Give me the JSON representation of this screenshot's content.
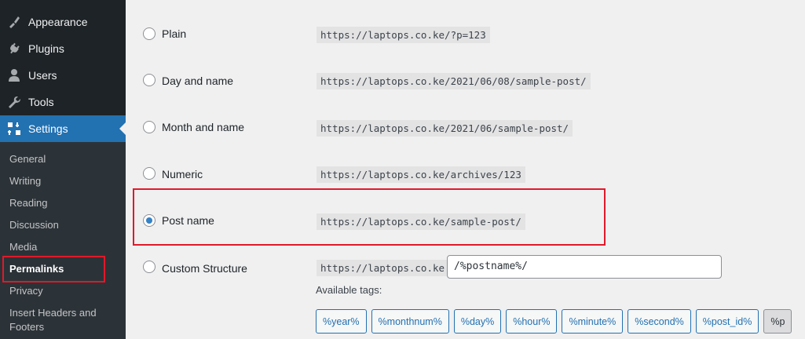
{
  "sidebar": {
    "menu": [
      {
        "label": "Appearance",
        "icon": "paintbrush-icon"
      },
      {
        "label": "Plugins",
        "icon": "plug-icon"
      },
      {
        "label": "Users",
        "icon": "user-icon"
      },
      {
        "label": "Tools",
        "icon": "wrench-icon"
      },
      {
        "label": "Settings",
        "icon": "settings-icon",
        "current": true
      }
    ],
    "submenu": [
      "General",
      "Writing",
      "Reading",
      "Discussion",
      "Media",
      "Permalinks",
      "Privacy",
      "Insert Headers and Footers"
    ]
  },
  "permalinks": {
    "options": [
      {
        "label": "Plain",
        "example": "https://laptops.co.ke/?p=123",
        "checked": false
      },
      {
        "label": "Day and name",
        "example": "https://laptops.co.ke/2021/06/08/sample-post/",
        "checked": false
      },
      {
        "label": "Month and name",
        "example": "https://laptops.co.ke/2021/06/sample-post/",
        "checked": false
      },
      {
        "label": "Numeric",
        "example": "https://laptops.co.ke/archives/123",
        "checked": false
      },
      {
        "label": "Post name",
        "example": "https://laptops.co.ke/sample-post/",
        "checked": true
      },
      {
        "label": "Custom Structure",
        "example": "https://laptops.co.ke",
        "checked": false
      }
    ],
    "custom_value": "/%postname%/",
    "available_tags_label": "Available tags:",
    "tags": [
      "%year%",
      "%monthnum%",
      "%day%",
      "%hour%",
      "%minute%",
      "%second%",
      "%post_id%",
      "%p"
    ]
  },
  "colors": {
    "highlight": "#e0192a",
    "accent": "#2271b1",
    "sidebar": "#1d2327"
  }
}
